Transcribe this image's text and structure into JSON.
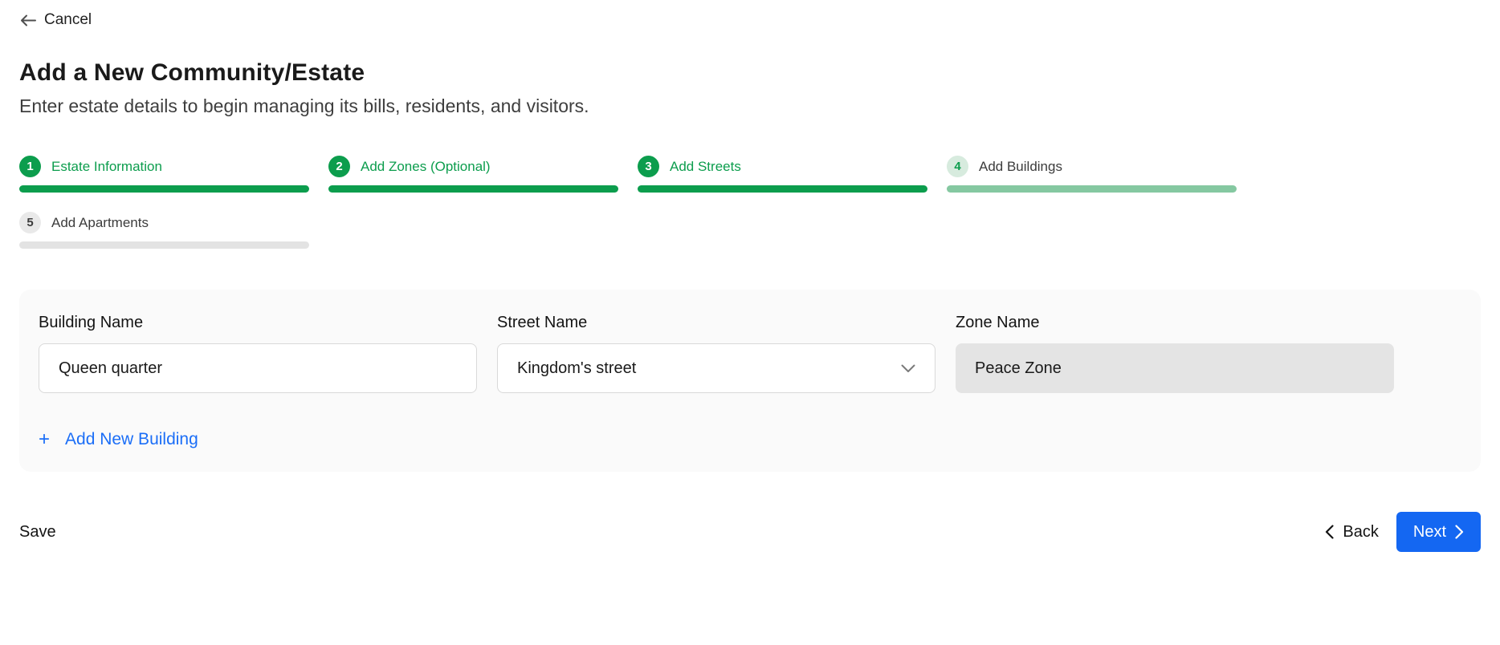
{
  "header": {
    "cancel_label": "Cancel"
  },
  "page": {
    "title": "Add a New Community/Estate",
    "subtitle": "Enter estate details to begin managing its bills, residents, and visitors."
  },
  "stepper": {
    "steps": [
      {
        "number": "1",
        "label": "Estate Information",
        "state": "complete"
      },
      {
        "number": "2",
        "label": "Add Zones (Optional)",
        "state": "complete"
      },
      {
        "number": "3",
        "label": "Add Streets",
        "state": "complete"
      },
      {
        "number": "4",
        "label": "Add Buildings",
        "state": "current"
      },
      {
        "number": "5",
        "label": "Add Apartments",
        "state": "upcoming"
      }
    ]
  },
  "form": {
    "building_name": {
      "label": "Building Name",
      "value": "Queen quarter"
    },
    "street_name": {
      "label": "Street Name",
      "value": "Kingdom's street"
    },
    "zone_name": {
      "label": "Zone Name",
      "value": "Peace Zone"
    },
    "add_building_label": "Add New Building",
    "plus_glyph": "+"
  },
  "footer": {
    "save_label": "Save",
    "back_label": "Back",
    "next_label": "Next"
  },
  "icons": {
    "back_arrow": "arrow-left-icon",
    "dropdown": "chevron-down-icon",
    "back_chevron": "chevron-left-icon",
    "next_chevron": "chevron-right-icon"
  },
  "colors": {
    "green": "#0c9d4d",
    "green_current_circle_bg": "#d7ebde",
    "green_current_bar": "#85c8a1",
    "upcoming_gray": "#e3e3e3",
    "card_bg": "#fafafa",
    "field_disabled_bg": "#e4e4e4",
    "link_blue": "#1b6ef7",
    "button_blue": "#1467f2"
  }
}
